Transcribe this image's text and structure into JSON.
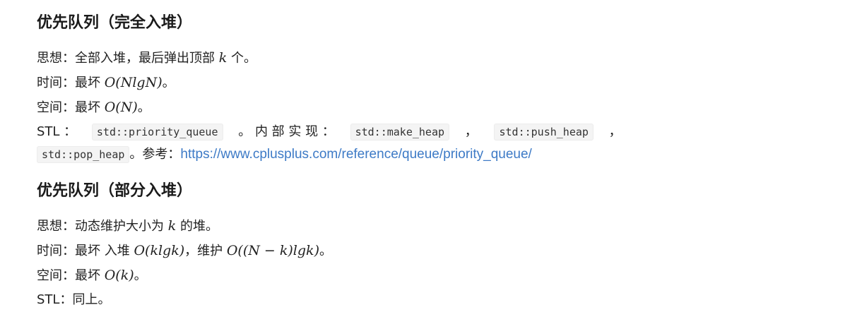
{
  "section1": {
    "title": "优先队列（完全入堆）",
    "idea_prefix": "思想：全部入堆，最后弹出顶部 ",
    "idea_var": "k",
    "idea_suffix": " 个。",
    "time_prefix": "时间：最坏 ",
    "time_math": "O(NlgN)",
    "time_suffix": "。",
    "space_prefix": "空间：最坏 ",
    "space_math": "O(N)",
    "space_suffix": "。",
    "stl_label": "STL ：",
    "stl_code": "std::priority_queue",
    "stl_mid": "。 内 部 实 现 ：",
    "impl_code_1": "std::make_heap",
    "sep_1": "，",
    "impl_code_2": "std::push_heap",
    "sep_2": "，",
    "impl_code_3": "std::pop_heap",
    "ref_prefix": "。参考：",
    "ref_link": "https://www.cplusplus.com/reference/queue/priority_queue/"
  },
  "section2": {
    "title": "优先队列（部分入堆）",
    "idea_prefix": "思想：动态维护大小为 ",
    "idea_var": "k",
    "idea_suffix": " 的堆。",
    "time_prefix": "时间：最坏 入堆 ",
    "time_math_1": "O(klgk)",
    "time_mid": "，维护 ",
    "time_math_2": "O((N − k)lgk)",
    "time_suffix": "。",
    "space_prefix": "空间：最坏 ",
    "space_math": "O(k)",
    "space_suffix": "。",
    "stl_line": "STL：同上。"
  }
}
